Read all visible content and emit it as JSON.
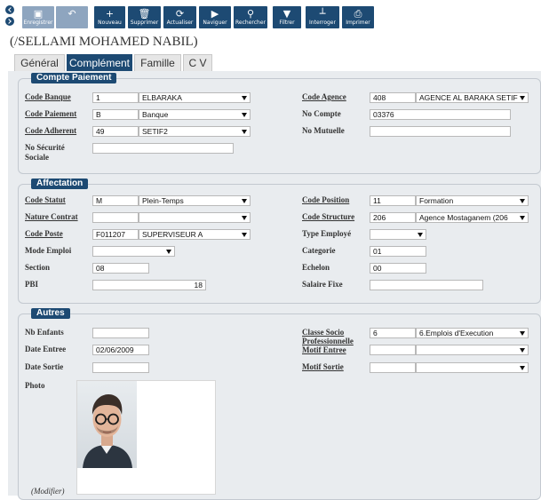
{
  "toolbar": {
    "buttons": [
      {
        "label": "Enregistrer",
        "icon": "▣"
      },
      {
        "label": "",
        "icon": "↶"
      },
      {
        "label": "Nouveau",
        "icon": "+"
      },
      {
        "label": "Supprimer",
        "icon": "🗑"
      },
      {
        "label": "Actualiser",
        "icon": "⟳"
      },
      {
        "label": "Naviguer",
        "icon": "▶"
      },
      {
        "label": "Rechercher",
        "icon": "⚲"
      },
      {
        "label": "Filtrer",
        "icon": "▼"
      },
      {
        "label": "Interroger",
        "icon": "┴"
      },
      {
        "label": "Imprimer",
        "icon": "⎙"
      }
    ]
  },
  "person": {
    "title": "(/SELLAMI MOHAMED NABIL)"
  },
  "tabs": [
    "Général",
    "Complément",
    "Famille",
    "C V"
  ],
  "compte": {
    "legend": "Compte Paiement",
    "code_banque": {
      "label": "Code Banque",
      "code": "1",
      "name": "ELBARAKA"
    },
    "code_agence": {
      "label": "Code Agence",
      "code": "408",
      "name": "AGENCE AL BARAKA SETIF"
    },
    "code_paiement": {
      "label": "Code Paiement",
      "code": "B",
      "name": "Banque"
    },
    "no_compte": {
      "label": "No Compte",
      "value": "03376"
    },
    "code_adherent": {
      "label": "Code Adherent",
      "code": "49",
      "name": "SETIF2"
    },
    "no_mutuelle": {
      "label": "No Mutuelle",
      "value": ""
    },
    "no_secu": {
      "label1": "No Sécurité",
      "label2": "Sociale",
      "value": ""
    }
  },
  "affectation": {
    "legend": "Affectation",
    "code_statut": {
      "label": "Code Statut",
      "code": "M",
      "name": "Plein-Temps"
    },
    "code_position": {
      "label": "Code Position",
      "code": "11",
      "name": "Formation"
    },
    "nature_contrat": {
      "label": "Nature Contrat",
      "code": "",
      "name": ""
    },
    "code_structure": {
      "label": "Code Structure",
      "code": "206",
      "name": "Agence Mostaganem (206"
    },
    "code_poste": {
      "label": "Code Poste",
      "code": "F011207",
      "name": "SUPERVISEUR A"
    },
    "type_employe": {
      "label": "Type Employé",
      "value": ""
    },
    "mode_emploi": {
      "label": "Mode Emploi",
      "value": ""
    },
    "categorie": {
      "label": "Categorie",
      "value": "01"
    },
    "section": {
      "label": "Section",
      "value": "08"
    },
    "echelon": {
      "label": "Echelon",
      "value": "00"
    },
    "pbi": {
      "label": "PBI",
      "value": "18"
    },
    "salaire_fixe": {
      "label": "Salaire Fixe",
      "value": ""
    }
  },
  "autres": {
    "legend": "Autres",
    "nb_enfants": {
      "label": "Nb Enfants",
      "value": ""
    },
    "classe_socio": {
      "label1": "Classe Socio",
      "label2": "Professionnelle",
      "code": "6",
      "name": "6.Emplois d'Execution"
    },
    "date_entree": {
      "label": "Date Entree",
      "value": "02/06/2009"
    },
    "motif_entree": {
      "label": "Motif Entree",
      "code": "",
      "name": ""
    },
    "date_sortie": {
      "label": "Date Sortie",
      "value": ""
    },
    "motif_sortie": {
      "label": "Motif Sortie",
      "code": "",
      "name": ""
    },
    "photo": {
      "label": "Photo"
    },
    "modifier": "(Modifier)"
  }
}
